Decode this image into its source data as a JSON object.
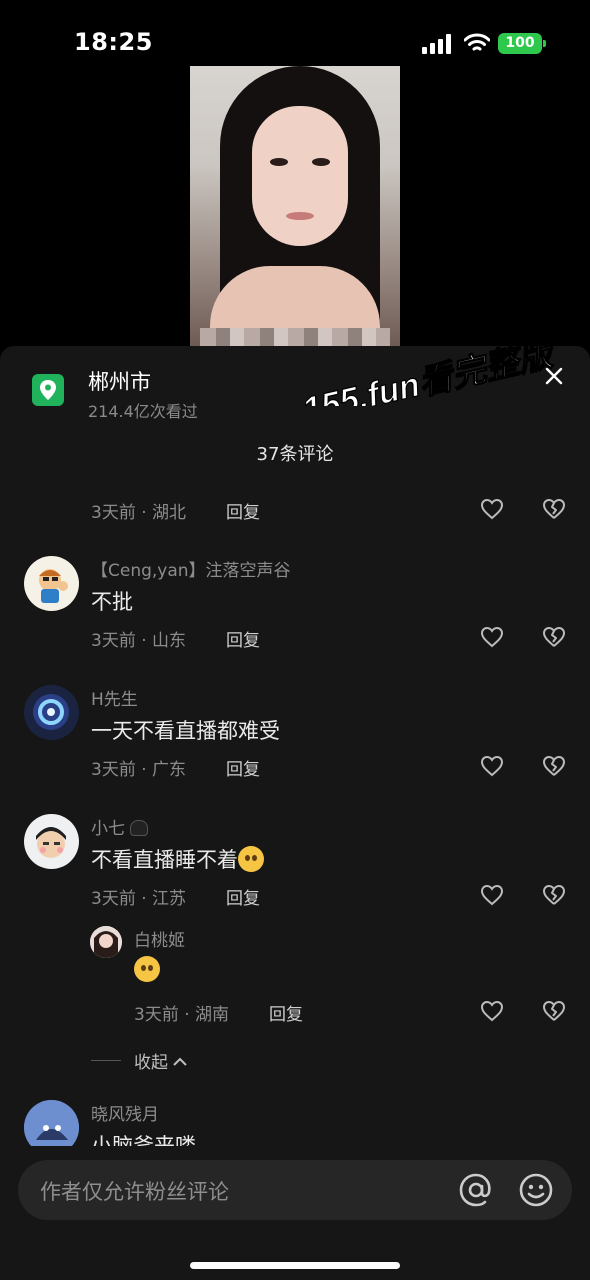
{
  "status_bar": {
    "time": "18:25",
    "battery": "100"
  },
  "location": {
    "name": "郴州市",
    "views": "214.4亿次看过"
  },
  "watermark": "155.fun看完整版",
  "comments_header": {
    "count_text": "37条评论"
  },
  "comments": [
    {
      "meta": "3天前 · 湖北",
      "reply": "回复"
    },
    {
      "user": "【Ceng,yan】注落空声谷",
      "text": "不批",
      "meta": "3天前 · 山东",
      "reply": "回复"
    },
    {
      "user": "H先生",
      "text": "一天不看直播都难受",
      "meta": "3天前 · 广东",
      "reply": "回复"
    },
    {
      "user": "小七",
      "text": "不看直播睡不着",
      "meta": "3天前 · 江苏",
      "reply": "回复"
    },
    {
      "user": "白桃姬",
      "meta": "3天前 · 湖南",
      "reply": "回复"
    },
    {
      "user": "晓风残月",
      "text": "小脑斧来喽"
    }
  ],
  "collapse_label": "收起",
  "input": {
    "placeholder": "作者仅允许粉丝评论"
  },
  "colors": {
    "location_icon": "#20b35b",
    "battery": "#2ec84c",
    "panel_bg": "#161616"
  }
}
